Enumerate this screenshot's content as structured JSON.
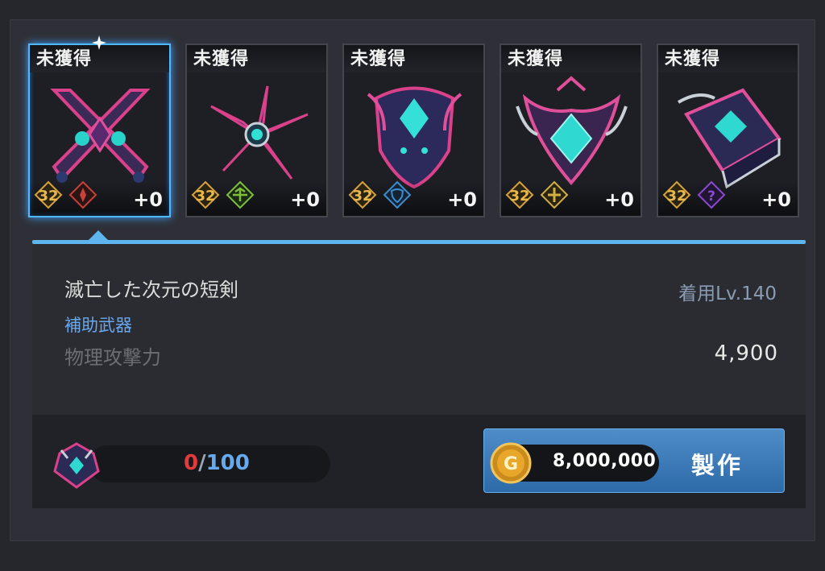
{
  "cards": [
    {
      "label": "未獲得",
      "level": "32",
      "plus": "+0",
      "type_icon": "warrior-icon",
      "type_color": "#c9413a",
      "selected": true
    },
    {
      "label": "未獲得",
      "level": "32",
      "plus": "+0",
      "type_icon": "archer-icon",
      "type_color": "#7fbf3a",
      "selected": false
    },
    {
      "label": "未獲得",
      "level": "32",
      "plus": "+0",
      "type_icon": "shield-icon",
      "type_color": "#3a8ed0",
      "selected": false
    },
    {
      "label": "未獲得",
      "level": "32",
      "plus": "+0",
      "type_icon": "cross-icon",
      "type_color": "#d0b040",
      "selected": false
    },
    {
      "label": "未獲得",
      "level": "32",
      "plus": "+0",
      "type_icon": "question-icon",
      "type_color": "#8a4bd0",
      "selected": false
    }
  ],
  "item": {
    "name": "滅亡した次元の短剣",
    "required_level": "着用Lv.140",
    "category": "補助武器",
    "stat_name": "物理攻撃力",
    "stat_value": "4,900"
  },
  "materials": {
    "have": "0",
    "separator": "/",
    "need": "100"
  },
  "craft": {
    "cost": "8,000,000",
    "label": "製作"
  },
  "colors": {
    "accent": "#5fb6ee",
    "gold": "#d6a235",
    "red": "#e23b3b"
  }
}
